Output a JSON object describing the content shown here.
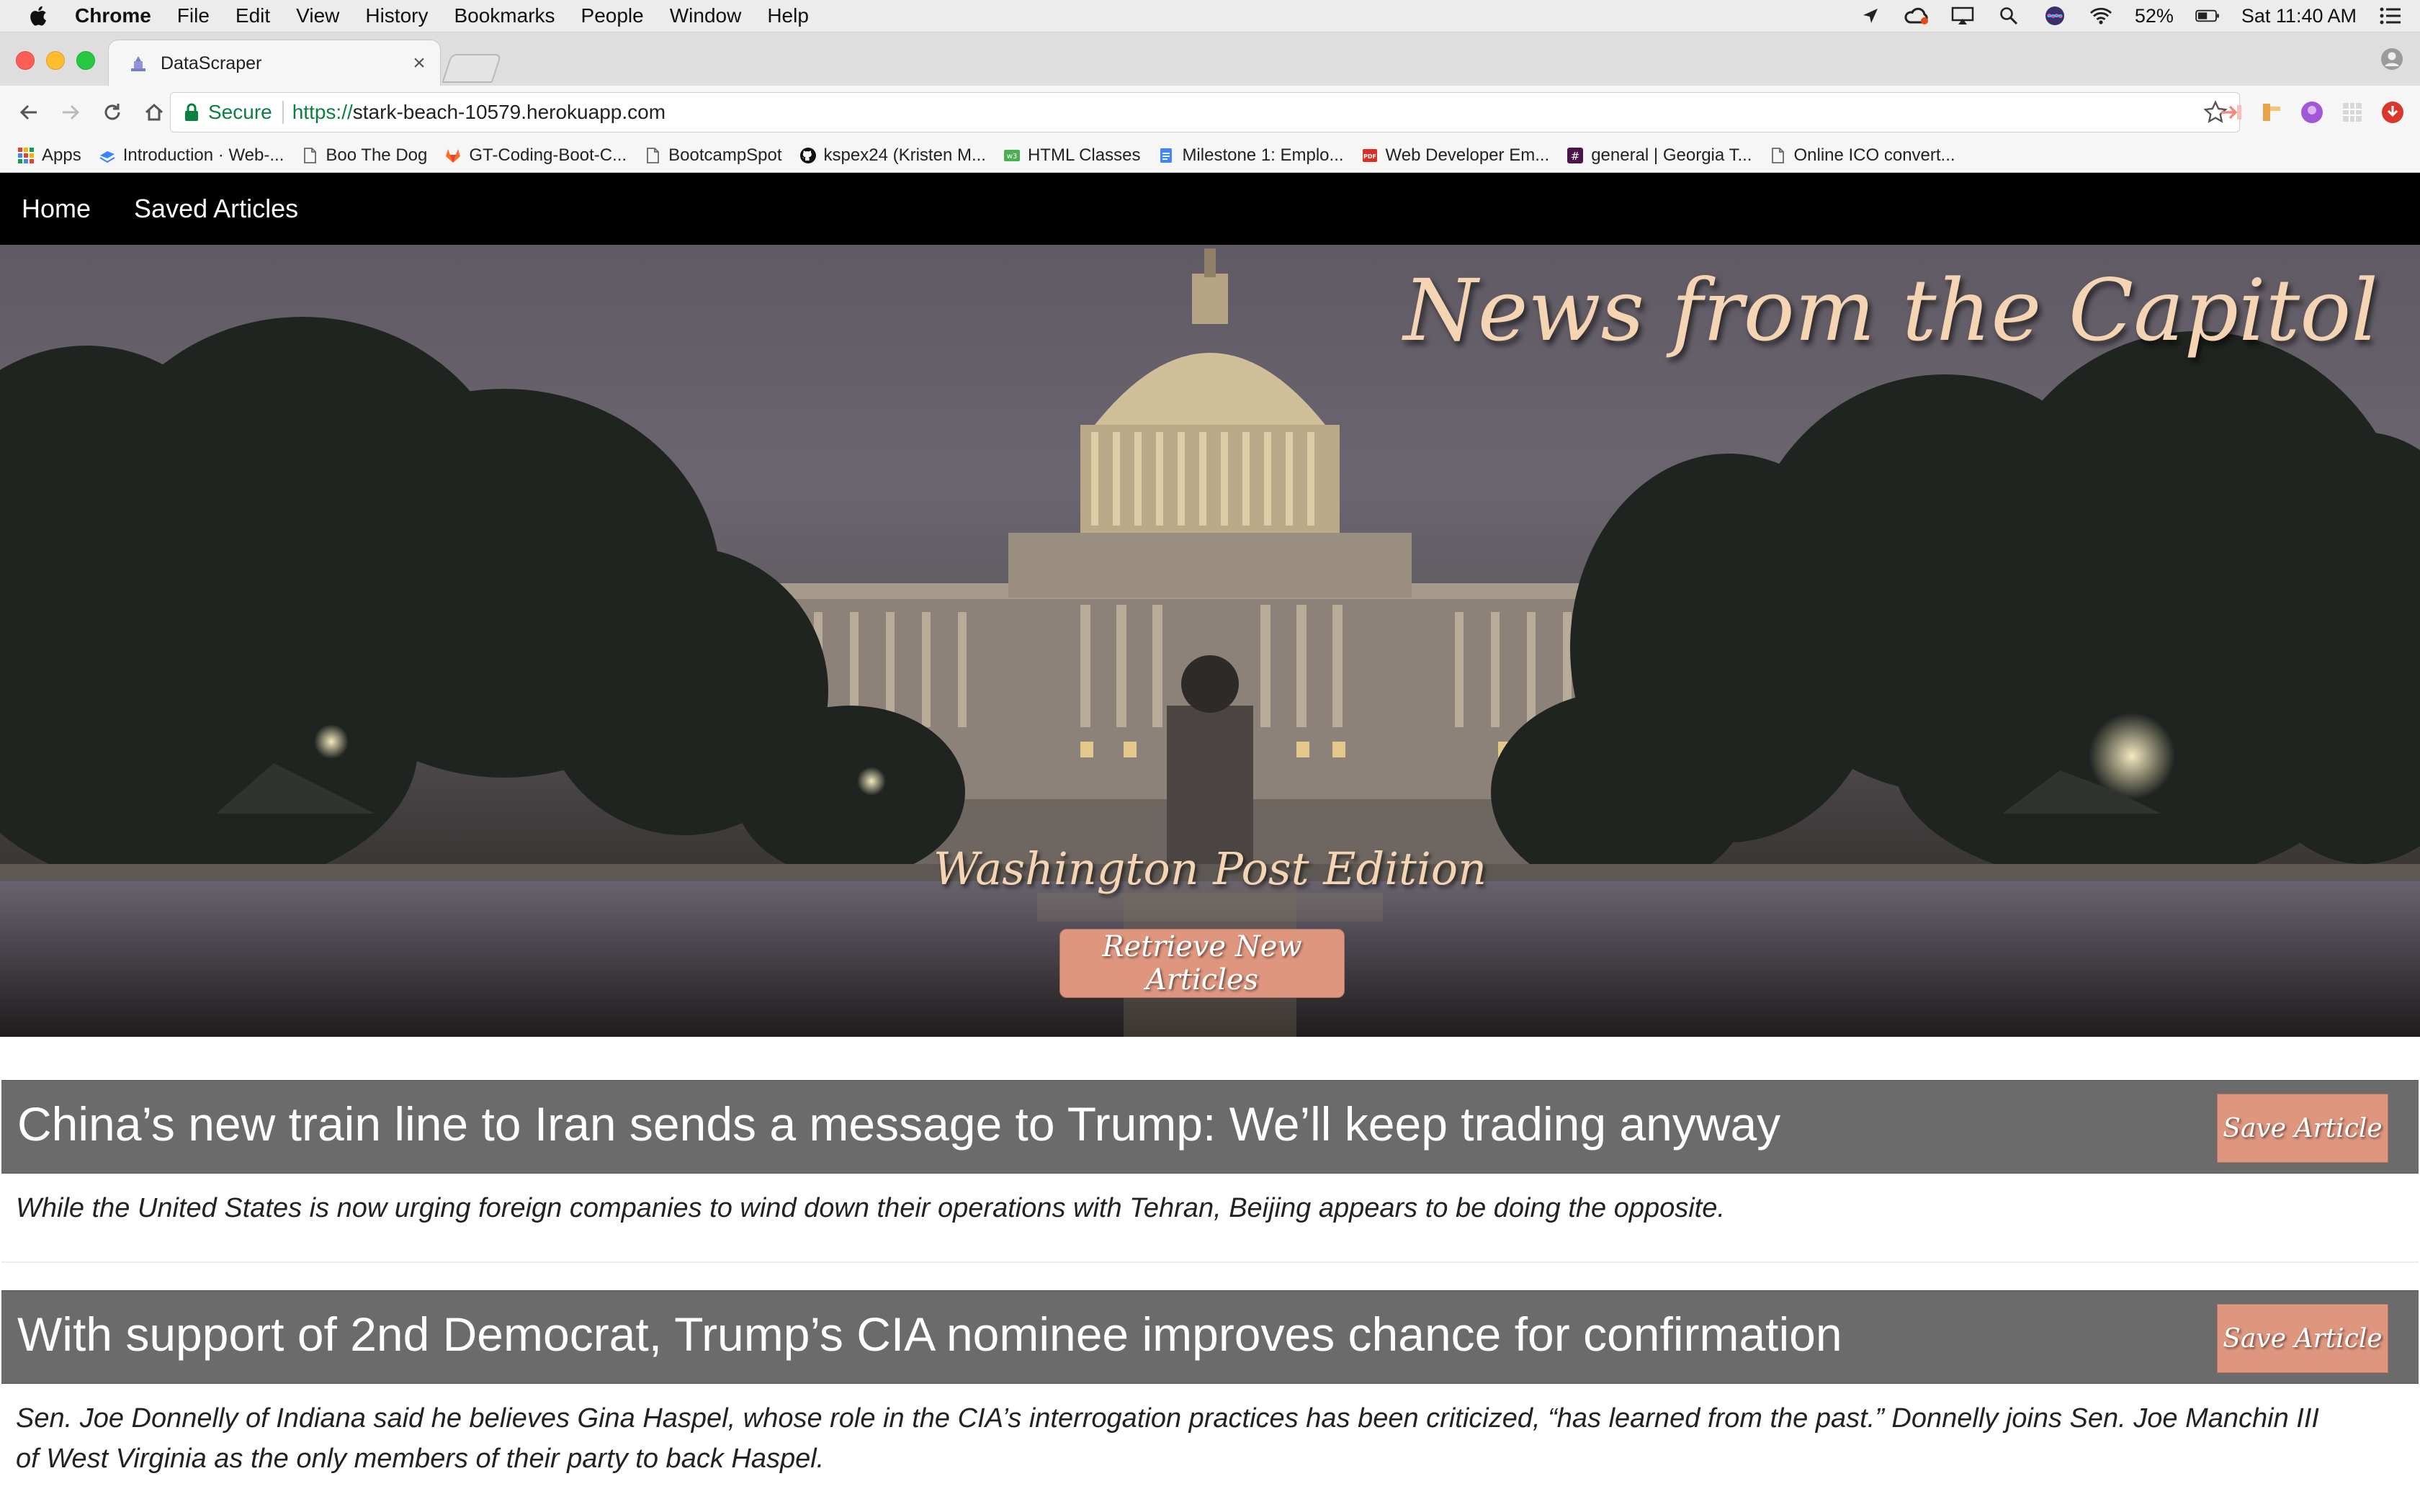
{
  "menubar": {
    "app": "Chrome",
    "items": [
      "File",
      "Edit",
      "View",
      "History",
      "Bookmarks",
      "People",
      "Window",
      "Help"
    ],
    "battery": "52%",
    "clock": "Sat 11:40 AM"
  },
  "browser": {
    "tab_title": "DataScraper",
    "secure_label": "Secure",
    "url_scheme": "https://",
    "url_host": "stark-beach-10579.herokuapp.com",
    "bookmarks": [
      {
        "label": "Apps",
        "icon": "apps-grid-icon"
      },
      {
        "label": "Introduction · Web-...",
        "icon": "gitbook-icon"
      },
      {
        "label": "Boo The Dog",
        "icon": "page-icon"
      },
      {
        "label": "GT-Coding-Boot-C...",
        "icon": "gitlab-icon"
      },
      {
        "label": "BootcampSpot",
        "icon": "page-icon"
      },
      {
        "label": "kspex24 (Kristen M...",
        "icon": "github-icon"
      },
      {
        "label": "HTML Classes",
        "icon": "w3schools-icon"
      },
      {
        "label": "Milestone 1: Emplo...",
        "icon": "docs-icon"
      },
      {
        "label": "Web Developer Em...",
        "icon": "pdf-icon"
      },
      {
        "label": "general | Georgia T...",
        "icon": "slack-icon"
      },
      {
        "label": "Online ICO convert...",
        "icon": "page-icon"
      }
    ]
  },
  "nav": {
    "home": "Home",
    "saved": "Saved Articles"
  },
  "hero": {
    "title": "News from the Capitol",
    "subtitle": "Washington Post Edition",
    "button": "Retrieve New Articles"
  },
  "articles": [
    {
      "title": "China’s new train line to Iran sends a message to Trump: We’ll keep trading anyway",
      "summary": "While the United States is now urging foreign companies to wind down their operations with Tehran, Beijing appears to be doing the opposite.",
      "save": "Save Article"
    },
    {
      "title": "With support of 2nd Democrat, Trump’s CIA nominee improves chance for confirmation",
      "summary": "Sen. Joe Donnelly of Indiana said he believes Gina Haspel, whose role in the CIA’s interrogation practices has been criticized, “has learned from the past.” Donnelly joins Sen. Joe Manchin III of West Virginia as the only members of their party to back Haspel.",
      "save": "Save Article"
    }
  ],
  "colors": {
    "accent_button": "#df967f",
    "hero_text": "#f4d4b2",
    "article_header": "#6b6b6b",
    "navbar": "#000000"
  }
}
